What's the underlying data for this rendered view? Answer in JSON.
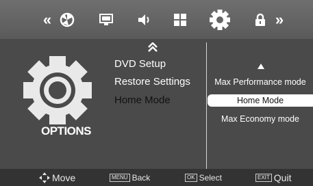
{
  "topbar": {
    "left_arrows": "«",
    "right_arrows": "»",
    "icons": [
      "picture-icon",
      "display-icon",
      "sound-icon",
      "channel-icon",
      "options-gear-icon",
      "lock-icon"
    ]
  },
  "panel": {
    "title": "OPTIONS",
    "menu_items": [
      {
        "label": "DVD Setup"
      },
      {
        "label": "Restore Settings"
      },
      {
        "label": "Home Mode"
      }
    ],
    "submenu": [
      {
        "label": "Max Performance mode"
      },
      {
        "label": "Home Mode"
      },
      {
        "label": "Max Economy mode"
      }
    ]
  },
  "footer": {
    "move": "Move",
    "menu_key": "MENU",
    "back": "Back",
    "ok_key": "OK",
    "select": "Select",
    "exit_key": "EXIT",
    "quit": "Quit"
  }
}
